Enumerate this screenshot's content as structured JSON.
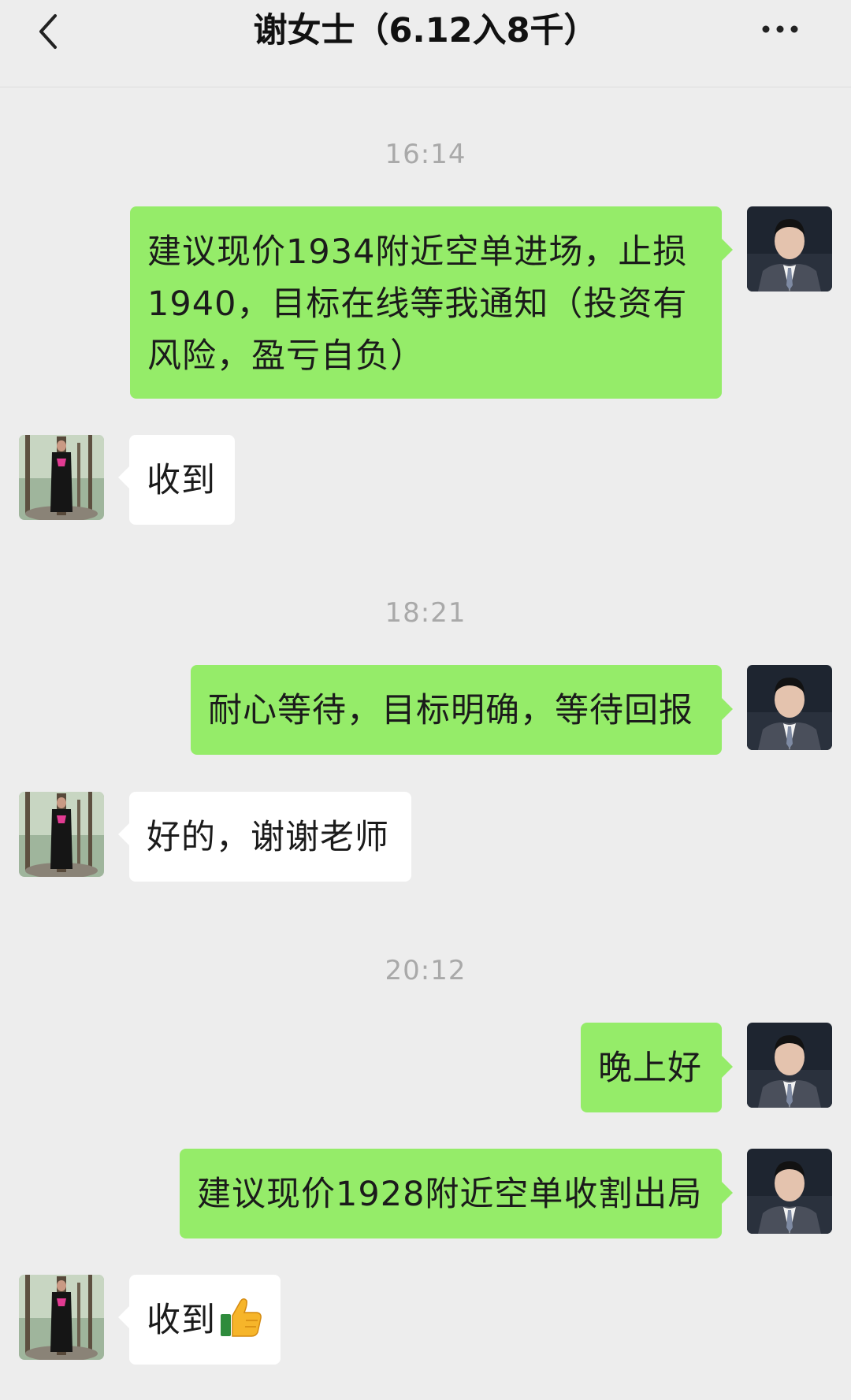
{
  "header": {
    "title": "谢女士（6.12入8千）",
    "back_icon": "chevron-left-icon",
    "more_icon": "more-icon"
  },
  "messages": [
    {
      "type": "time",
      "text": "16:14"
    },
    {
      "type": "msg",
      "from": "me",
      "text": "建议现价1934附近空单进场，止损1940，目标在线等我通知（投资有风险，盈亏自负）"
    },
    {
      "type": "msg",
      "from": "them",
      "text": "收到"
    },
    {
      "type": "time",
      "text": "18:21"
    },
    {
      "type": "msg",
      "from": "me",
      "text": "耐心等待，目标明确，等待回报"
    },
    {
      "type": "msg",
      "from": "them",
      "text": "好的，谢谢老师"
    },
    {
      "type": "time",
      "text": "20:12"
    },
    {
      "type": "msg",
      "from": "me",
      "text": "晚上好"
    },
    {
      "type": "msg",
      "from": "me",
      "text": "建议现价1928附近空单收割出局"
    },
    {
      "type": "msg",
      "from": "them",
      "text": "收到",
      "emoji": "thumbs-up-icon"
    }
  ],
  "colors": {
    "my_bubble": "#95ec69",
    "their_bubble": "#ffffff",
    "background": "#ededed"
  }
}
